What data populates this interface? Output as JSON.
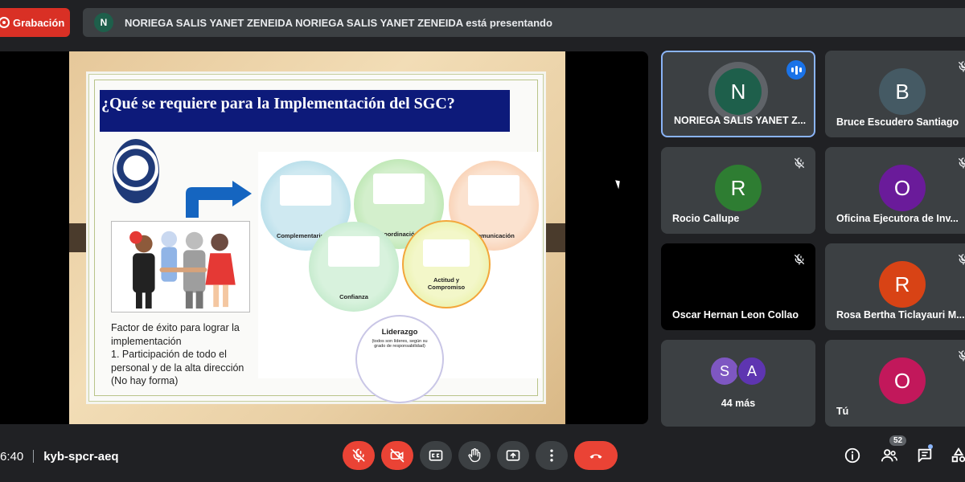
{
  "topbar": {
    "recording_label": "Grabación",
    "presenter_initial": "N",
    "presenting_text": "NORIEGA SALIS YANET ZENEIDA NORIEGA SALIS YANET ZENEIDA está presentando"
  },
  "slide": {
    "title": "¿Qué se requiere para la Implementación del SGC?",
    "factor_lines": [
      "Factor de éxito para lograr la",
      "implementación",
      "1. Participación de todo el",
      "personal y de la alta dirección",
      "(No hay forma)"
    ],
    "circles": {
      "complementariedad": "Complementariedad",
      "coordinacion": "Coordinación",
      "comunicacion": "Comunicación",
      "confianza": "Confianza",
      "actitud": "Actitud y Compromiso",
      "liderazgo": "Liderazgo",
      "liderazgo_note": "(todos son líderes, según su grado de responsabilidad)"
    }
  },
  "participants": [
    {
      "initial": "N",
      "name": "NORIEGA SALIS YANET Z...",
      "color": "#1e5f4b",
      "state": "speaking"
    },
    {
      "initial": "B",
      "name": "Bruce Escudero Santiago",
      "color": "#455a64",
      "state": "muted"
    },
    {
      "initial": "R",
      "name": "Rocio Callupe",
      "color": "#2e7d32",
      "state": "muted"
    },
    {
      "initial": "O",
      "name": "Oficina Ejecutora de Inv...",
      "color": "#6a1b9a",
      "state": "muted"
    },
    {
      "initial": "",
      "name": "Oscar Hernan Leon Collao",
      "color": "#000000",
      "state": "muted"
    },
    {
      "initial": "R",
      "name": "Rosa Bertha Ticlayauri M...",
      "color": "#d84315",
      "state": "muted"
    },
    {
      "initial": "O",
      "name": "Tú",
      "color": "#c2185b",
      "state": "muted"
    }
  ],
  "more": {
    "initials": [
      "S",
      "A"
    ],
    "label": "44 más"
  },
  "bottombar": {
    "time": "6:40",
    "meeting_code": "kyb-spcr-aeq",
    "people_count": "52"
  }
}
